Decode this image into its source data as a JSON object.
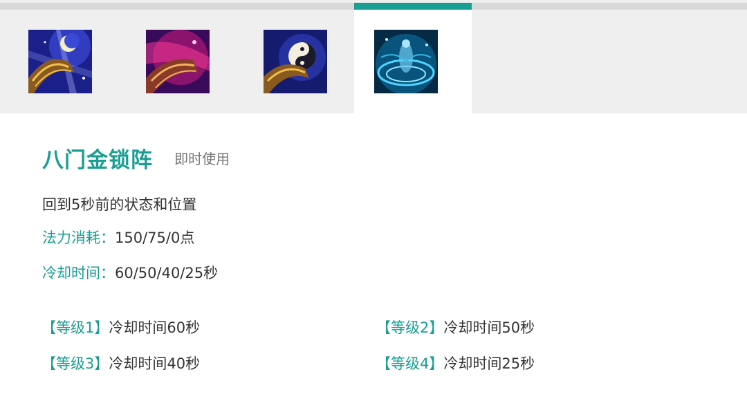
{
  "tabs": [
    {
      "icon": "crescent-moon-skill-icon",
      "active": false
    },
    {
      "icon": "pink-sleeve-skill-icon",
      "active": false
    },
    {
      "icon": "yin-yang-skill-icon",
      "active": false
    },
    {
      "icon": "blue-vortex-skill-icon",
      "active": true
    }
  ],
  "skill": {
    "name": "八门金锁阵",
    "type": "即时使用",
    "description": "回到5秒前的状态和位置",
    "mana_label": "法力消耗：",
    "mana_value": "150/75/0点",
    "cooldown_label": "冷却时间：",
    "cooldown_value": "60/50/40/25秒"
  },
  "levels": [
    {
      "tag": "【等级1】",
      "text": "冷却时间60秒"
    },
    {
      "tag": "【等级2】",
      "text": "冷却时间50秒"
    },
    {
      "tag": "【等级3】",
      "text": "冷却时间40秒"
    },
    {
      "tag": "【等级4】",
      "text": "冷却时间25秒"
    }
  ],
  "colors": {
    "accent": "#1a9e93",
    "text": "#333333",
    "muted": "#777777",
    "tab_bg": "#efefef"
  }
}
